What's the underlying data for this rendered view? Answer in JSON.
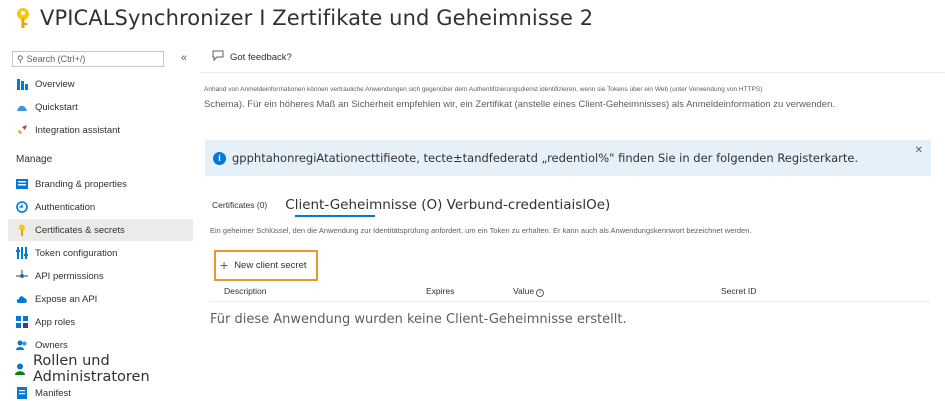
{
  "page": {
    "title": "VPICALSynchronizer I Zertifikate und Geheimnisse 2"
  },
  "sidebar": {
    "search_placeholder": "Search (Ctrl+/)",
    "collapse_glyph": "«",
    "items_top": [
      {
        "label": "Overview",
        "icon": "overview-icon"
      },
      {
        "label": "Quickstart",
        "icon": "quickstart-icon"
      },
      {
        "label": "Integration assistant",
        "icon": "rocket-icon"
      }
    ],
    "section_manage": "Manage",
    "items_manage": [
      {
        "label": "Branding & properties",
        "icon": "branding-icon"
      },
      {
        "label": "Authentication",
        "icon": "authentication-icon"
      },
      {
        "label": "Certificates & secrets",
        "icon": "key-icon",
        "active": true
      },
      {
        "label": "Token configuration",
        "icon": "token-icon"
      },
      {
        "label": "API permissions",
        "icon": "api-permissions-icon"
      },
      {
        "label": "Expose an API",
        "icon": "cloud-icon"
      },
      {
        "label": "App roles",
        "icon": "app-roles-icon"
      },
      {
        "label": "Owners",
        "icon": "owners-icon"
      },
      {
        "label": "Rollen und Administratoren",
        "icon": "roles-icon"
      },
      {
        "label": "Manifest",
        "icon": "manifest-icon"
      }
    ]
  },
  "toolbar": {
    "feedback_label": "Got feedback?"
  },
  "description": {
    "line1": "Anhand von Anmeldeinformationen können vertrauliche Anwendungen sich gegenüber dem Authentifizierungsdienst identifizieren, wenn sie Tokens über ein Web (unter Verwendung von HTTPS)",
    "line2": "Schema). Für ein höheres Maß an Sicherheit empfehlen wir, ein Zertifikat (anstelle eines Client-Geheimnisses) als Anmeldeinformation zu verwenden."
  },
  "banner": {
    "text": "gpphtahonregiAtationecttifieote, tecte±tandfederatd „redentiol%\" finden Sie in der folgenden Registerkarte.",
    "close": "✕"
  },
  "tabs": {
    "certificates": "Certificates (0)",
    "client_secrets": "Client-Geheimnisse (O) Verbund-credentiaislOe)"
  },
  "tab_description": "Ein geheimer Schlüssel, den die Anwendung zur Identitätsprüfung anfordert, um ein Token zu erhalten. Er kann auch als Anwendungskennwort bezeichnet werden.",
  "new_secret_button": "New client secret",
  "table": {
    "columns": [
      "Description",
      "Expires",
      "Value",
      "Secret ID"
    ],
    "value_info": "i"
  },
  "empty_message": "Für diese Anwendung wurden keine Client-Geheimnisse erstellt.",
  "colors": {
    "accent": "#0078d4",
    "highlight_border": "#e59b2e",
    "banner_bg": "#e6f0f9"
  }
}
